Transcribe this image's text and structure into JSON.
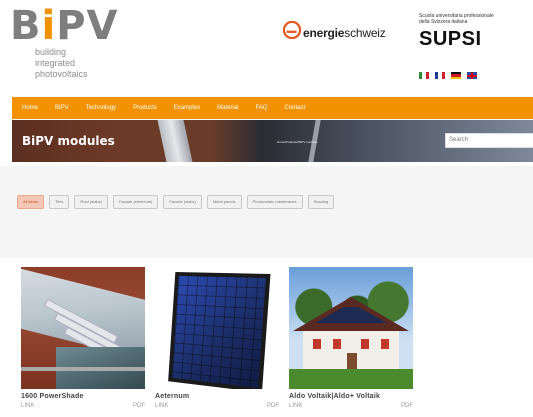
{
  "header": {
    "logo": {
      "prefix": "B",
      "accent": "i",
      "suffix": "PV",
      "subtitle": [
        "building",
        "integrated",
        "photovoltaics"
      ]
    },
    "partner": {
      "brand_bold": "energie",
      "brand_rest": "schweiz",
      "accent_color": "#e2591f"
    },
    "school": {
      "small_lines": [
        "Scuola universitaria professionale",
        "della Svizzera italiana"
      ],
      "name": "SUPSI"
    },
    "languages": [
      "italian-flag",
      "french-flag",
      "german-flag",
      "english-flag"
    ]
  },
  "nav": {
    "items": [
      "Home",
      "BIPV",
      "Technology",
      "Products",
      "Examples",
      "Material",
      "FAQ",
      "Contact"
    ],
    "color": "#f39200"
  },
  "banner": {
    "title": "BiPV modules",
    "breadcrumb": "Home/Products/BIPV modules",
    "search_placeholder": "Search"
  },
  "filters": {
    "items": [
      "All items",
      "Tiles",
      "Roof (slabs)",
      "Facade (elements)",
      "Facade (slabs)",
      "Metal panels",
      "Photovoltaic membranes",
      "Shading"
    ],
    "active": "All items"
  },
  "products": [
    {
      "title": "1600 PowerShade",
      "link": "LINK",
      "doc": "PDF"
    },
    {
      "title": "Aeternum",
      "link": "LINK",
      "doc": "PDF"
    },
    {
      "title": "Aldo Voltaik|Aldo+ Voltaik",
      "link": "LINK",
      "doc": "PDF"
    }
  ]
}
